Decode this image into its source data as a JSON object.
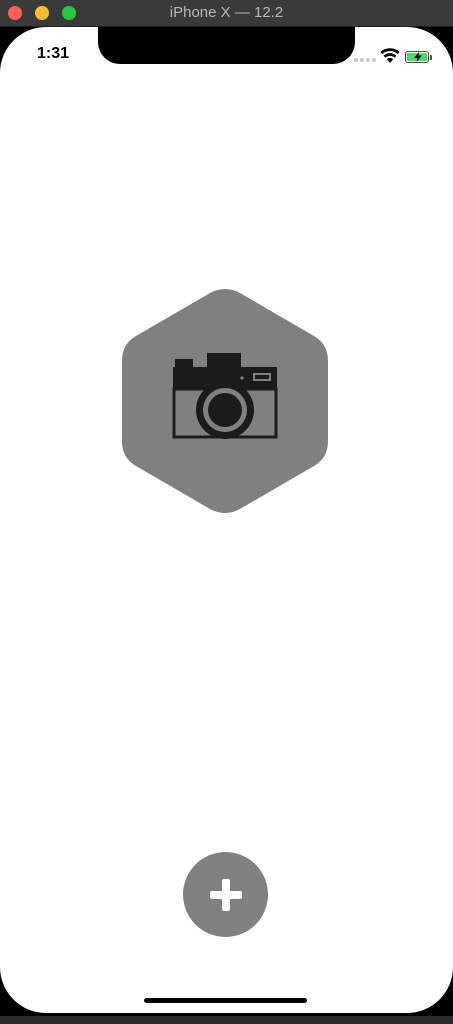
{
  "window": {
    "title": "iPhone X — 12.2"
  },
  "status_bar": {
    "time": "1:31",
    "battery_state": "charging",
    "battery_color": "#4cd964"
  },
  "main": {
    "hero_icon": "camera-icon",
    "hero_shape": "hexagon",
    "hero_color": "#808080"
  },
  "fab": {
    "icon": "plus-icon",
    "color": "#808080"
  }
}
